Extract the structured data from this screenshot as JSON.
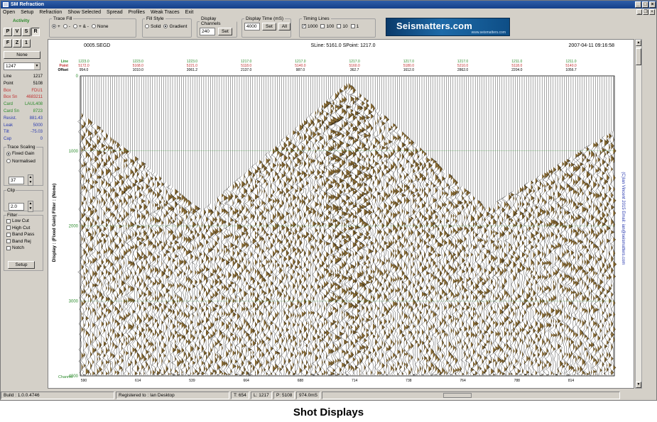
{
  "window": {
    "title": "SM Refraction",
    "menu": [
      "Open",
      "Setup",
      "Refraction",
      "Show Selected",
      "Spread",
      "Profiles",
      "Weak Traces",
      "Exit"
    ]
  },
  "toolbar": {
    "trace_fill": {
      "legend": "Trace Fill",
      "options": [
        "+",
        "-",
        "+ & -",
        "None"
      ],
      "selected": 0
    },
    "fill_style": {
      "legend": "Fill Style",
      "options": [
        "Solid",
        "Gradient"
      ],
      "selected": 1
    },
    "display_channels": {
      "legend": "Display Channels",
      "value": "240",
      "set_label": "Set"
    },
    "display_time": {
      "legend": "Display Time (mS)",
      "value": "4000",
      "set_label": "Set",
      "all_label": "All"
    },
    "timing_lines": {
      "legend": "Timing Lines",
      "options": [
        "1000",
        "100",
        "10",
        "1"
      ],
      "checked": [
        true,
        false,
        false,
        false
      ]
    },
    "logo": {
      "text": "Seismatters.com",
      "url": "www.seismatters.com"
    }
  },
  "left_panel": {
    "activity_label": "Activity",
    "activity_buttons_row1": [
      "P",
      "V",
      "S",
      "R"
    ],
    "activity_buttons_row2": [
      "F",
      "Z",
      "1"
    ],
    "pressed_button": "R",
    "none_button": "None",
    "line_select": "1247",
    "info": [
      {
        "label": "Line",
        "value": "1217",
        "color": "#000000"
      },
      {
        "label": "Point",
        "value": "5108",
        "color": "#000000"
      },
      {
        "label": "Box",
        "value": "FDU1",
        "color": "#c03030"
      },
      {
        "label": "Box Sn",
        "value": "4683211",
        "color": "#c03030"
      },
      {
        "label": "Card",
        "value": "LAUL408",
        "color": "#2a8a2a"
      },
      {
        "label": "Card Sn",
        "value": "8723",
        "color": "#2a8a2a"
      },
      {
        "label": "Resist.",
        "value": "881.43",
        "color": "#2a3ab0"
      },
      {
        "label": "Leak",
        "value": "5000",
        "color": "#2a3ab0"
      },
      {
        "label": "Tilt",
        "value": "-75.03",
        "color": "#2a3ab0"
      },
      {
        "label": "Cap",
        "value": "0",
        "color": "#2a3ab0"
      }
    ],
    "trace_scaling": {
      "legend": "Trace Scaling",
      "options": [
        "Fixed Gain",
        "Normalised"
      ],
      "selected": 0,
      "gain_value": "37"
    },
    "clip": {
      "legend": "Clip",
      "value": "2.0"
    },
    "filter": {
      "legend": "Filter",
      "options": [
        "Low Cut",
        "High Cut",
        "Band Pass",
        "Band Rej",
        "Notch"
      ],
      "setup_label": "Setup"
    }
  },
  "display": {
    "file": "0005.SEGD",
    "header_center": "SLine: 5161.0  SPoint: 1217.0",
    "datetime": "2007-04-11 09:16:58",
    "row_labels": [
      "Line",
      "Point",
      "Offset"
    ],
    "row_colors": [
      "#2a8a2a",
      "#c03030",
      "#000000"
    ],
    "columns": [
      {
        "line": "1223.0",
        "point": "5172.0",
        "offset": "954.0"
      },
      {
        "line": "1223.0",
        "point": "5168.0",
        "offset": "1010.0"
      },
      {
        "line": "1223.0",
        "point": "5221.0",
        "offset": "3061.2"
      },
      {
        "line": "1217.0",
        "point": "5118.0",
        "offset": "2137.0"
      },
      {
        "line": "1217.0",
        "point": "5140.0",
        "offset": "987.0"
      },
      {
        "line": "1217.0",
        "point": "5160.0",
        "offset": "362.7"
      },
      {
        "line": "1217.0",
        "point": "5180.0",
        "offset": "1612.0"
      },
      {
        "line": "1217.0",
        "point": "5210.0",
        "offset": "2862.0"
      },
      {
        "line": "1211.0",
        "point": "5118.0",
        "offset": "2204.0"
      },
      {
        "line": "1211.0",
        "point": "5140.0",
        "offset": "1056.7"
      }
    ],
    "time_ticks": [
      "0",
      "1000",
      "2000",
      "3000",
      "4000"
    ],
    "channel_label": "Channel",
    "channel_ticks": [
      "590",
      "614",
      "539",
      "664",
      "688",
      "714",
      "738",
      "764",
      "788",
      "814"
    ],
    "y_axis_label": "Display : (Fixed Gain)    Filter : (None)",
    "right_label": "(C)Ian Vincent 2015   Email: ian@seismatters.com"
  },
  "status": {
    "build": "Build : 1.0.0.4746",
    "registered": "Registered to : Ian Desktop",
    "t": "T: 654",
    "l": "L: 1217",
    "p": "P: 5108",
    "time": "974.0mS"
  },
  "caption": "Shot Displays",
  "colors": {
    "accent": "#1d6aa8",
    "wiggle": "#000000",
    "fill": "#7a5a1e",
    "fill_dark": "#4d3810",
    "timing_line": "#2a8a2a"
  },
  "icons": [
    "app-icon",
    "minimize-icon",
    "maximize-icon",
    "close-icon",
    "dropdown-arrow-icon",
    "spin-up-icon",
    "spin-down-icon",
    "scroll-up-icon",
    "scroll-down-icon"
  ]
}
